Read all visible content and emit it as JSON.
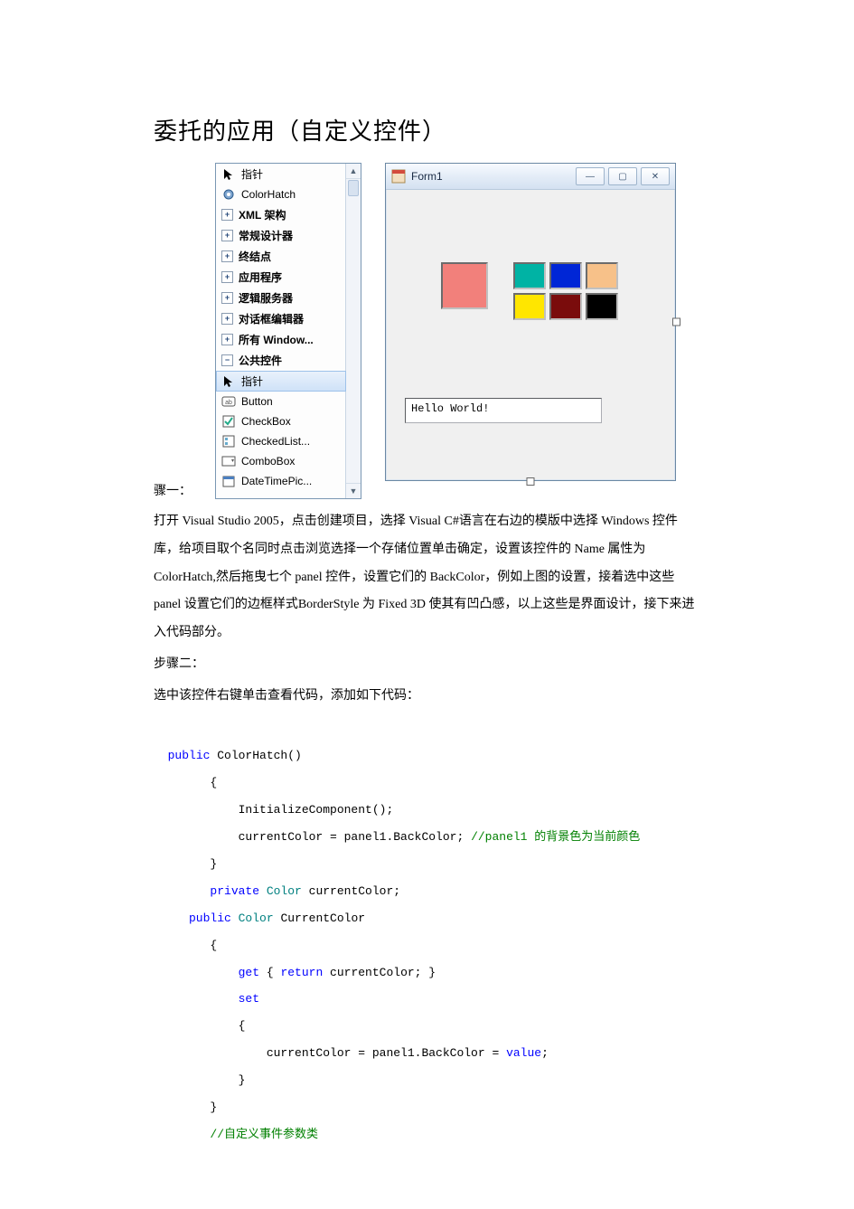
{
  "title": "委托的应用（自定义控件）",
  "step_lead": "骤一：",
  "toolbox": {
    "items": [
      {
        "icon": "pointer",
        "label": "指针",
        "bold": false
      },
      {
        "icon": "gear",
        "label": "ColorHatch",
        "bold": false
      },
      {
        "icon": "plus",
        "label": "XML 架构",
        "bold": true
      },
      {
        "icon": "plus",
        "label": "常规设计器",
        "bold": true
      },
      {
        "icon": "plus",
        "label": "终结点",
        "bold": true
      },
      {
        "icon": "plus",
        "label": "应用程序",
        "bold": true
      },
      {
        "icon": "plus",
        "label": "逻辑服务器",
        "bold": true
      },
      {
        "icon": "plus",
        "label": "对话框编辑器",
        "bold": true
      },
      {
        "icon": "plus",
        "label": "所有 Window...",
        "bold": true
      },
      {
        "icon": "minus",
        "label": "公共控件",
        "bold": true
      },
      {
        "icon": "pointer",
        "label": "指针",
        "bold": false,
        "selected": true
      },
      {
        "icon": "btn",
        "label": "Button",
        "bold": false
      },
      {
        "icon": "chk",
        "label": "CheckBox",
        "bold": false
      },
      {
        "icon": "clb",
        "label": "CheckedList...",
        "bold": false
      },
      {
        "icon": "cmb",
        "label": "ComboBox",
        "bold": false
      },
      {
        "icon": "dtp",
        "label": "DateTimePic...",
        "bold": false
      }
    ]
  },
  "form": {
    "title": "Form1",
    "bigColor": "#f2807b",
    "swatches": [
      "#00b3a4",
      "#0026d6",
      "#f7c189",
      "#ffe600",
      "#7a0c0c",
      "#000000"
    ],
    "textValue": "Hello World!"
  },
  "paragraphs": [
    "打开 Visual Studio 2005，点击创建项目，选择 Visual C#语言在右边的模版中选择 Windows 控件库，给项目取个名同时点击浏览选择一个存储位置单击确定，设置该控件的 Name 属性为 ColorHatch,然后拖曳七个 panel 控件，设置它们的 BackColor，例如上图的设置，接着选中这些 panel 设置它们的边框样式BorderStyle 为 Fixed 3D 使其有凹凸感，以上这些是界面设计，接下来进入代码部分。",
    "步骤二：",
    "选中该控件右键单击查看代码，添加如下代码："
  ],
  "code": {
    "l1a": "public",
    "l1b": " ColorHatch()",
    "l2": "        {",
    "l3": "            InitializeComponent();",
    "l4a": "            currentColor = panel1.BackColor;",
    "l4b": " //panel1 的背景色为当前颜色",
    "l5": "        }",
    "l6a": "        private",
    "l6b": " Color",
    "l6c": " currentColor;",
    "l7a": "     public",
    "l7b": " Color",
    "l7c": " CurrentColor",
    "l8": "        {",
    "l9a": "            get",
    "l9b": " { ",
    "l9c": "return",
    "l9d": " currentColor; }",
    "l10": "            set",
    "l11": "            {",
    "l12a": "                currentColor = panel1.BackColor = ",
    "l12b": "value",
    "l12c": ";",
    "l13": "            }",
    "l14": "        }",
    "l15": "        //自定义事件参数类"
  }
}
